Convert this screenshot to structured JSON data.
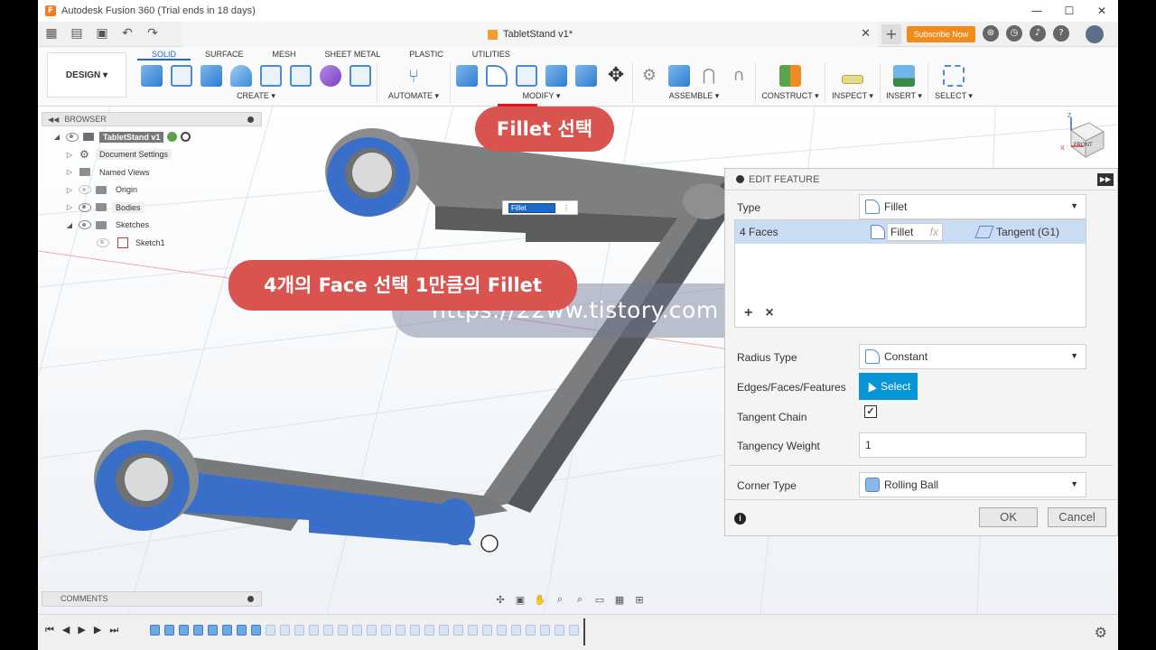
{
  "window": {
    "title": "Autodesk Fusion 360 (Trial ends in 18 days)",
    "minimize": "—",
    "maximize": "☐",
    "close": "✕"
  },
  "tabstrip": {
    "doc_title": "TabletStand v1*",
    "close": "✕",
    "add": "+",
    "subscribe": "Subscribe Now"
  },
  "ribbon": {
    "workspace": "DESIGN ▾",
    "tabs": [
      "SOLID",
      "SURFACE",
      "MESH",
      "SHEET METAL",
      "PLASTIC",
      "UTILITIES"
    ],
    "active_tab": "SOLID",
    "groups": {
      "create": "CREATE ▾",
      "automate": "AUTOMATE ▾",
      "modify": "MODIFY ▾",
      "assemble": "ASSEMBLE ▾",
      "construct": "CONSTRUCT ▾",
      "inspect": "INSPECT ▾",
      "insert": "INSERT ▾",
      "select": "SELECT ▾"
    }
  },
  "browser": {
    "title": "BROWSER",
    "items": [
      {
        "label": "TabletStand v1",
        "level": 0
      },
      {
        "label": "Document Settings",
        "level": 1
      },
      {
        "label": "Named Views",
        "level": 1
      },
      {
        "label": "Origin",
        "level": 1
      },
      {
        "label": "Bodies",
        "level": 1
      },
      {
        "label": "Sketches",
        "level": 1
      },
      {
        "label": "Sketch1",
        "level": 2
      }
    ]
  },
  "canvas": {
    "fillet_tag_value": "Fillet",
    "callout_top": "Fillet 선택",
    "callout_mid": "4개의 Face 선택 1만큼의 Fillet",
    "watermark": "https://22ww.tistory.com"
  },
  "viewcube": {
    "face_label": "FRONT",
    "axis_x": "X",
    "axis_z": "Z"
  },
  "edit_feature": {
    "title": "EDIT FEATURE",
    "type_label": "Type",
    "type_value": "Fillet",
    "selection_row": {
      "count": "4 Faces",
      "mode": "Fillet",
      "fx": "fx",
      "continuity": "Tangent (G1)"
    },
    "radius_type_label": "Radius Type",
    "radius_type_value": "Constant",
    "edges_label": "Edges/Faces/Features",
    "select_button": "Select",
    "tangent_chain_label": "Tangent Chain",
    "tangent_chain_checked": true,
    "tangency_weight_label": "Tangency Weight",
    "tangency_weight_value": "1",
    "corner_type_label": "Corner Type",
    "corner_type_value": "Rolling Ball",
    "ok": "OK",
    "cancel": "Cancel"
  },
  "comments": {
    "title": "COMMENTS"
  },
  "colors": {
    "accent": "#1b6ac9",
    "callout": "#d9534f",
    "highlight": "#e0151b",
    "face_select": "#3a6fc9",
    "select_button": "#0696d7"
  }
}
